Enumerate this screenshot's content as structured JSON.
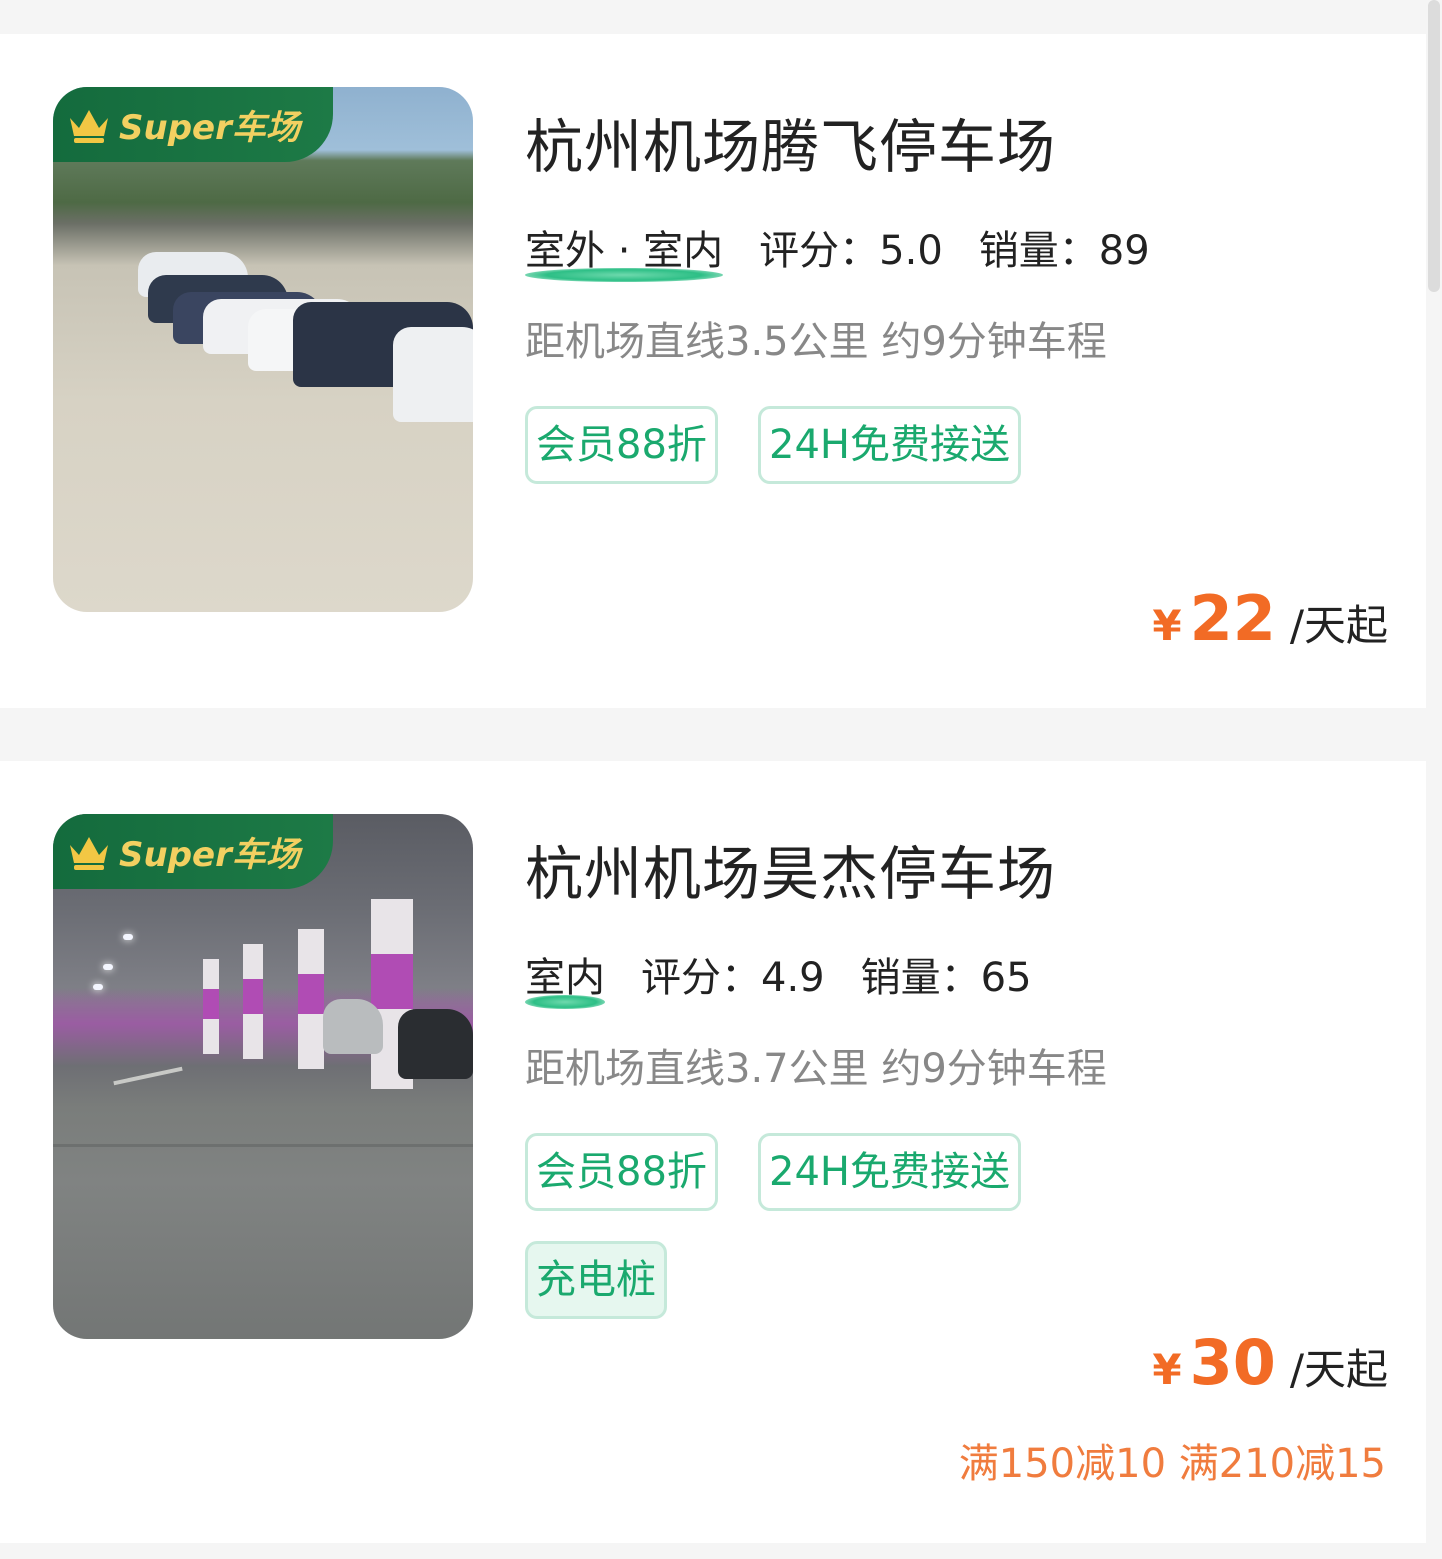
{
  "lots": [
    {
      "badge": "Super车场",
      "title": "杭州机场腾飞停车场",
      "environment": "室外 · 室内",
      "rating_label": "评分：5.0",
      "sales_label": "销量：89",
      "distance": "距机场直线3.5公里 约9分钟车程",
      "tags": [
        "会员88折",
        "24H免费接送"
      ],
      "price_symbol": "¥",
      "price": "22",
      "price_unit": "/天起",
      "photo_icon": "outdoor-parking-photo"
    },
    {
      "badge": "Super车场",
      "title": "杭州机场昊杰停车场",
      "environment": "室内",
      "rating_label": "评分：4.9",
      "sales_label": "销量：65",
      "distance": "距机场直线3.7公里 约9分钟车程",
      "tags": [
        "会员88折",
        "24H免费接送",
        "充电桩"
      ],
      "price_symbol": "¥",
      "price": "30",
      "price_unit": "/天起",
      "promo": "满150减10 满210减15",
      "photo_icon": "indoor-parking-photo"
    }
  ],
  "colors": {
    "accent_green": "#1aa96e",
    "badge_green": "#146b3d",
    "badge_text": "#f2d061",
    "price_orange": "#f26b25",
    "promo_orange": "#f07c3e"
  }
}
